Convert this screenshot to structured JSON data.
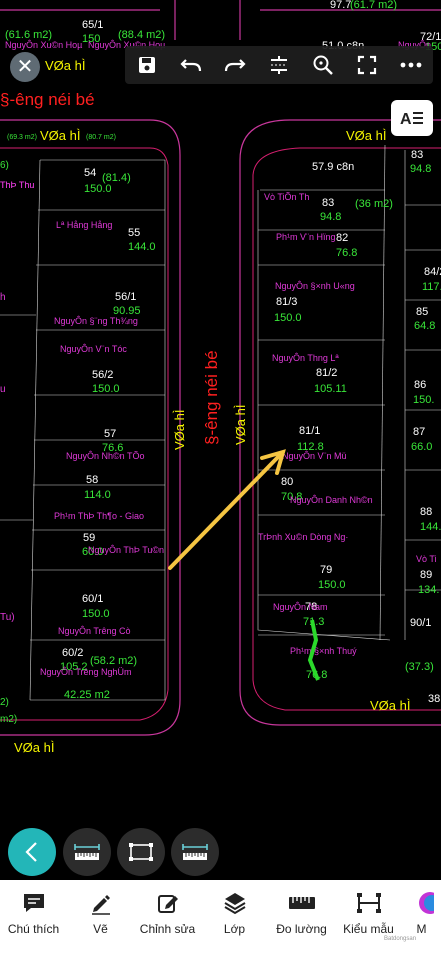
{
  "toolbar": {
    "close_icon": "close-icon",
    "icons": [
      "save-icon",
      "undo-icon",
      "redo-icon",
      "compress-icon",
      "zoom-icon",
      "fullscreen-icon",
      "more-icon"
    ]
  },
  "map": {
    "road_main": "§-êng néi bé",
    "road_main_top": "§-êng néi bé",
    "path_labels": [
      "VØa hÌ",
      "VØa hÌ",
      "VØa hÌ",
      "VØa hÌ",
      "VØa hÌ",
      "VØa hÌ"
    ],
    "areas_top": [
      "(61.6 m2)",
      "65/1",
      "150",
      "(88.4 m2)",
      "97.7",
      "(61.7 m2)",
      "72/1",
      "150",
      "51.0 c8n",
      "(69.3 m2)",
      "(80.7 m2)"
    ],
    "owners_top": [
      "NguyÔn Xu©n Hoµ",
      "NguyÔn Xu©n Hoµ",
      "NguyÔn"
    ],
    "left_lots": [
      {
        "id": "54",
        "extra": "(81.4)",
        "area": "150.0",
        "owner": "ThÞ Thu"
      },
      {
        "id": "55",
        "area": "144.0",
        "owner": "Lª Hång Hång"
      },
      {
        "id": "56/1",
        "area": "90.95",
        "owner": "NguyÔn §¨ng Th¾ng"
      },
      {
        "id": "56/2",
        "area": "150.0",
        "owner": "NguyÔn V¨n Tóc"
      },
      {
        "id": "57",
        "area": "76.6",
        "owner": "NguyÔn Nh©n TÕo"
      },
      {
        "id": "58",
        "area": "114.0",
        "owner": ""
      },
      {
        "id": "59",
        "area": "60.0",
        "owner": "Ph¹m ThÞ Th¶o - Giao"
      },
      {
        "id": "",
        "area": "",
        "owner": "NguyÔn ThÞ Tu©n"
      },
      {
        "id": "60/1",
        "area": "150.0",
        "owner": "NguyÔn Tr­êng Cò"
      },
      {
        "id": "60/2",
        "area": "105.2",
        "extra": "(58.2 m2)",
        "owner": "NguyÔn Tr­êng NghÜ­m"
      },
      {
        "id": "",
        "area": "42.25 m2",
        "owner": ""
      }
    ],
    "right_lots": [
      {
        "id": "",
        "area": "57.9 c8n",
        "owner": ""
      },
      {
        "id": "83",
        "area": "94.8",
        "extra": "(36 m2)",
        "owner": "Vò TiÕn Th"
      },
      {
        "id": "82",
        "area": "76.8",
        "owner": "Ph¹m V¨n Hïng"
      },
      {
        "id": "81/3",
        "area": "150.0",
        "owner": "NguyÔn §×nh U«ng"
      },
      {
        "id": "81/2",
        "area": "105.11",
        "owner": "NguyÔn Th­ng Lª"
      },
      {
        "id": "81/1",
        "area": "112.8",
        "owner": "NguyÔn V¨n Mü"
      },
      {
        "id": "80",
        "area": "70.8",
        "owner": "NguyÔn Danh Nh©n"
      },
      {
        "id": "79",
        "area": "150.0",
        "owner": "TrÞnh Xu©n Dòng Ng·"
      },
      {
        "id": "78",
        "area": "71.3",
        "owner": "NguyÔn Nam"
      },
      {
        "id": "",
        "area": "76.8",
        "owner": "Ph¹m §×nh Thuý"
      }
    ],
    "far_right": [
      "83",
      "94.8",
      "84/2",
      "117.",
      "85",
      "64.8",
      "86",
      "150.",
      "87",
      "66.0",
      "88",
      "144.",
      "89",
      "134.",
      "90/1",
      "(37.3)",
      "38",
      "Vò Ti"
    ],
    "far_left_small": [
      "6)",
      "ThÞ Thu",
      "h",
      "u",
      "Tu)",
      "2)",
      "m2)"
    ],
    "bottom_path": "VØa hÌ",
    "arrow_color": "#f5c542"
  },
  "controls": {
    "back_icon": "chevron-left-icon",
    "mini_icons": [
      "ruler-horizontal-icon",
      "rectangle-measure-icon",
      "ruler-both-icon"
    ]
  },
  "bottom_nav": {
    "items": [
      {
        "label": "Chú thích",
        "icon": "comment-icon"
      },
      {
        "label": "Vẽ",
        "icon": "pen-icon"
      },
      {
        "label": "Chỉnh sửa",
        "icon": "edit-icon"
      },
      {
        "label": "Lớp",
        "icon": "layers-icon"
      },
      {
        "label": "Đo lường",
        "icon": "ruler-icon"
      },
      {
        "label": "Kiểu mẫu",
        "icon": "template-icon"
      },
      {
        "label": "M",
        "icon": "color-icon"
      }
    ]
  },
  "watermark": "Batdongsan"
}
